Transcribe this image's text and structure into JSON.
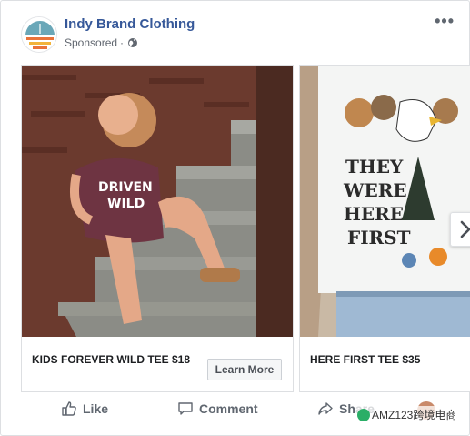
{
  "header": {
    "page_name": "Indy Brand Clothing",
    "sponsored": "Sponsored",
    "separator": "·",
    "more_label": "•••",
    "logo_icon": "sunset-stripes-logo",
    "colors": {
      "name": "#365899",
      "logo_sky": "#6aa7b8",
      "logo_orange": "#e9733a",
      "logo_yellow": "#f2b33b"
    }
  },
  "carousel": {
    "cards": [
      {
        "title": "KIDS FOREVER WILD TEE $18",
        "button_label": "Learn More",
        "photo": "child-on-stairs-photo",
        "shirt_text": "DRIVEN WILD"
      },
      {
        "title": "HERE FIRST TEE $35",
        "photo": "animals-tee-photo",
        "shirt_text": "THEY WERE HERE FIRST"
      }
    ],
    "next_icon": "chevron-right-icon"
  },
  "actions": {
    "like": "Like",
    "comment": "Comment",
    "share": "Share"
  },
  "watermark": "AMZ123跨境电商"
}
